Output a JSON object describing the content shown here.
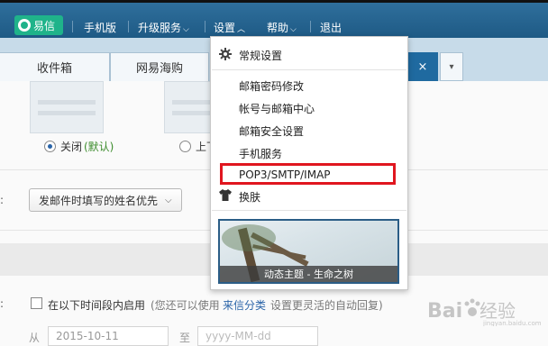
{
  "topnav": {
    "yixin": "易信",
    "mobile": "手机版",
    "upgrade": "升级服务",
    "settings": "设置",
    "help": "帮助",
    "logout": "退出"
  },
  "tabs": [
    {
      "label": "收件箱"
    },
    {
      "label": "网易海购"
    }
  ],
  "active_tab_close": "×",
  "content": {
    "radio_off_label": "关闭",
    "radio_off_default": "(默认)",
    "radio_on_label": "上下",
    "sender_name_select": "发邮件时填写的姓名优先",
    "enable_period_label": "在以下时间段内启用",
    "hint_prefix": "(您还可以使用",
    "hint_link": "来信分类",
    "hint_suffix": "设置更灵活的自动回复)",
    "from_label": "从",
    "from_date": "2015-10-11",
    "to_label": "至",
    "to_date_placeholder": "yyyy-MM-dd"
  },
  "settings_menu": {
    "header": "常规设置",
    "items": [
      {
        "label": "邮箱密码修改"
      },
      {
        "label": "帐号与邮箱中心"
      },
      {
        "label": "邮箱安全设置"
      },
      {
        "label": "手机服务"
      },
      {
        "label": "POP3/SMTP/IMAP"
      }
    ],
    "skin": "换肤",
    "theme_caption": "动态主题 - 生命之树"
  },
  "colors": {
    "highlight_border": "#e0161f",
    "topbar": "#1e5a85",
    "yixin_badge": "#1fb38a"
  },
  "icons": [
    "yixin-logo-icon",
    "chevron-down-icon",
    "chevron-up-icon",
    "gear-icon",
    "tshirt-icon",
    "close-icon"
  ]
}
